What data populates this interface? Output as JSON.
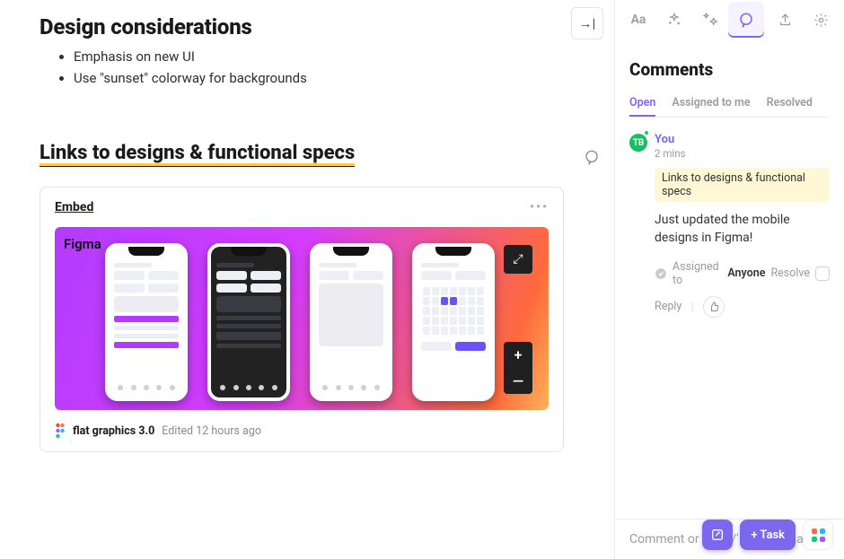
{
  "doc": {
    "section1_title": "Design considerations",
    "bullets": [
      "Emphasis on new UI",
      "Use \"sunset\" colorway for backgrounds"
    ],
    "section2_title": "Links to designs & functional specs",
    "collapse_tooltip": "Collapse panel"
  },
  "embed": {
    "label": "Embed",
    "canvas_brand": "Figma",
    "file_name": "flat graphics 3.0",
    "edited_prefix": "Edited",
    "edited_time": "12 hours ago",
    "menu_glyph": "•••",
    "expand_glyph": "⤢",
    "zoom_in": "+",
    "zoom_out": "—"
  },
  "side": {
    "title": "Comments",
    "tabs": [
      "Open",
      "Assigned to me",
      "Resolved"
    ],
    "active_tab": 0,
    "icons": {
      "text": "Aa"
    }
  },
  "comment": {
    "avatar_initials": "TB",
    "author": "You",
    "time": "2 mins",
    "ref": "Links to designs & functional specs",
    "body": "Just updated the mobile designs in Figma!",
    "assigned_label": "Assigned to",
    "assigned_value": "Anyone",
    "resolve_label": "Resolve",
    "reply_label": "Reply"
  },
  "composer": {
    "placeholder": "Comment or type '/' for commands"
  },
  "bottombar": {
    "task_label": "+ Task"
  },
  "colors": {
    "accent": "#7b68ee",
    "highlight": "#ffcc33",
    "ref_bg": "#fff7d6",
    "avatar_bg": "#17bf63"
  }
}
